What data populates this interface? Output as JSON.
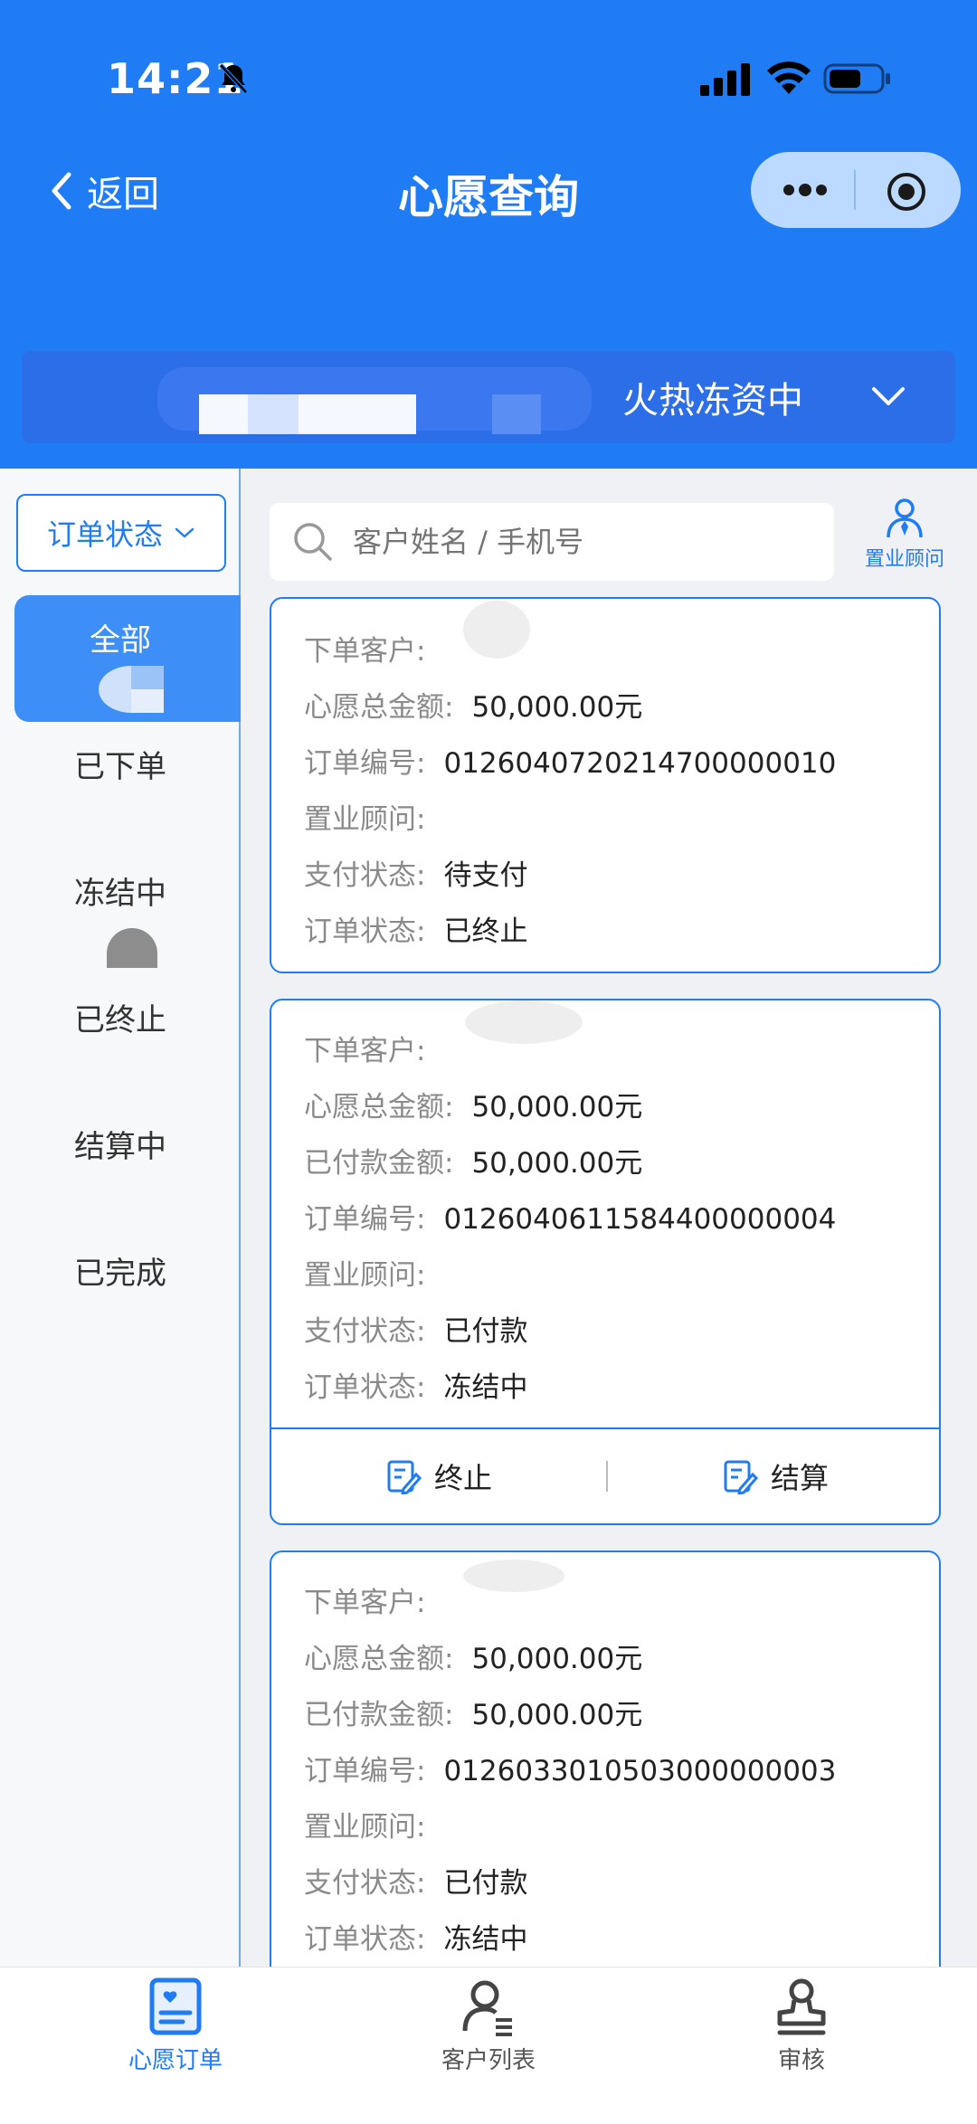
{
  "status": {
    "time": "14:21"
  },
  "nav": {
    "back_label": "返回",
    "title": "心愿查询"
  },
  "project": {
    "name": "火热冻资中"
  },
  "sidebar": {
    "filter_label": "订单状态",
    "categories": [
      {
        "label": "全部"
      },
      {
        "label": "已下单"
      },
      {
        "label": "冻结中"
      },
      {
        "label": "已终止"
      },
      {
        "label": "结算中"
      },
      {
        "label": "已完成"
      }
    ]
  },
  "search": {
    "placeholder": "客户姓名 / 手机号"
  },
  "advisor_label": "置业顾问",
  "cards": [
    {
      "rows": [
        {
          "k": "下单客户:",
          "v": ""
        },
        {
          "k": "心愿总金额:",
          "v": "50,000.00元"
        },
        {
          "k": "订单编号:",
          "v": "012604072021470000001​0"
        },
        {
          "k": "置业顾问:",
          "v": ""
        },
        {
          "k": "支付状态:",
          "v": "待支付"
        },
        {
          "k": "订单状态:",
          "v": "已终止"
        }
      ]
    },
    {
      "rows": [
        {
          "k": "下单客户:",
          "v": ""
        },
        {
          "k": "心愿总金额:",
          "v": "50,000.00元"
        },
        {
          "k": "已付款金额:",
          "v": "50,000.00元"
        },
        {
          "k": "订单编号:",
          "v": "0126040611584400000004"
        },
        {
          "k": "置业顾问:",
          "v": ""
        },
        {
          "k": "支付状态:",
          "v": "已付款"
        },
        {
          "k": "订单状态:",
          "v": "冻结中"
        }
      ],
      "actions": [
        "终止",
        "结算"
      ]
    },
    {
      "rows": [
        {
          "k": "下单客户:",
          "v": ""
        },
        {
          "k": "心愿总金额:",
          "v": "50,000.00元"
        },
        {
          "k": "已付款金额:",
          "v": "50,000.00元"
        },
        {
          "k": "订单编号:",
          "v": "0126033010503000000003"
        },
        {
          "k": "置业顾问:",
          "v": ""
        },
        {
          "k": "支付状态:",
          "v": "已付款"
        },
        {
          "k": "订单状态:",
          "v": "冻结中"
        }
      ]
    }
  ],
  "tabs": [
    {
      "label": "心愿订单",
      "icon": "wish-order-icon"
    },
    {
      "label": "客户列表",
      "icon": "customer-list-icon"
    },
    {
      "label": "审核",
      "icon": "stamp-icon"
    }
  ],
  "colors": {
    "primary": "#1f7cf4",
    "background": "#f0f1f5"
  }
}
